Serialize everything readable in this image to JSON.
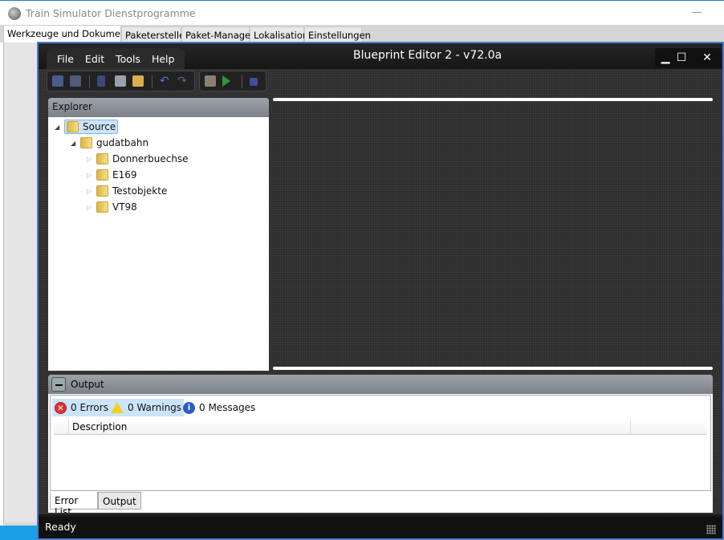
{
  "app": {
    "title": "Train Simulator Dienstprogramme",
    "tabs": [
      "Werkzeuge und Dokumente",
      "Paketersteller",
      "Paket-Manager",
      "Lokalisation",
      "Einstellungen"
    ]
  },
  "editor": {
    "title": "Blueprint Editor 2 - v72.0a",
    "menu": [
      "File",
      "Edit",
      "Tools",
      "Help"
    ]
  },
  "explorer": {
    "title": "Explorer",
    "root": "Source",
    "child": "gudatbahn",
    "items": [
      "Donnerbuechse",
      "E169",
      "Testobjekte",
      "VT98"
    ]
  },
  "output": {
    "title": "Output",
    "errors": "0 Errors",
    "warnings": "0 Warnings",
    "messages": "0 Messages",
    "column": "Description",
    "tabs": [
      "Error List",
      "Output"
    ]
  },
  "status": "Ready"
}
